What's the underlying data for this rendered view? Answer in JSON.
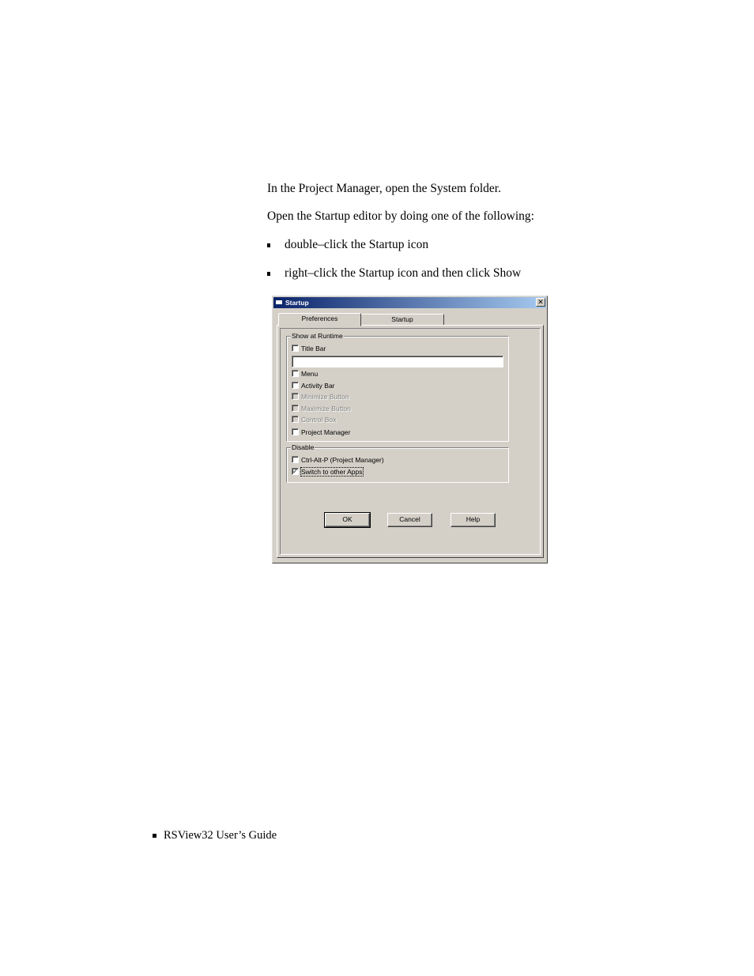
{
  "doc": {
    "paragraph_1": "In the Project Manager, open the System folder.",
    "paragraph_2": "Open the Startup editor by doing one of the following:",
    "bullets": [
      "double–click the Startup icon",
      "right–click the Startup icon and then click Show"
    ],
    "footer": "RSView32  User’s Guide"
  },
  "dialog": {
    "title": "Startup",
    "close_glyph": "✕",
    "tabs": [
      {
        "label": "Preferences",
        "active": true
      },
      {
        "label": "Startup",
        "active": false
      }
    ],
    "show_at_runtime": {
      "label": "Show at Runtime",
      "items": [
        {
          "label": "Title Bar",
          "checked": false,
          "enabled": true
        },
        {
          "label": "Menu",
          "checked": false,
          "enabled": true
        },
        {
          "label": "Activity Bar",
          "checked": false,
          "enabled": true
        },
        {
          "label": "Minimize Button",
          "checked": false,
          "enabled": false
        },
        {
          "label": "Maximize Button",
          "checked": false,
          "enabled": false
        },
        {
          "label": "Control Box",
          "checked": false,
          "enabled": false
        },
        {
          "label": "Project Manager",
          "checked": false,
          "enabled": true
        }
      ],
      "title_text_value": ""
    },
    "disable": {
      "label": "Disable",
      "items": [
        {
          "label": "Ctrl-Alt-P (Project Manager)",
          "checked": false,
          "enabled": true
        },
        {
          "label": "Switch to other Apps",
          "checked": true,
          "enabled": true
        }
      ]
    },
    "check_glyph": "✓",
    "buttons": {
      "ok": "OK",
      "cancel": "Cancel",
      "help": "Help"
    }
  }
}
